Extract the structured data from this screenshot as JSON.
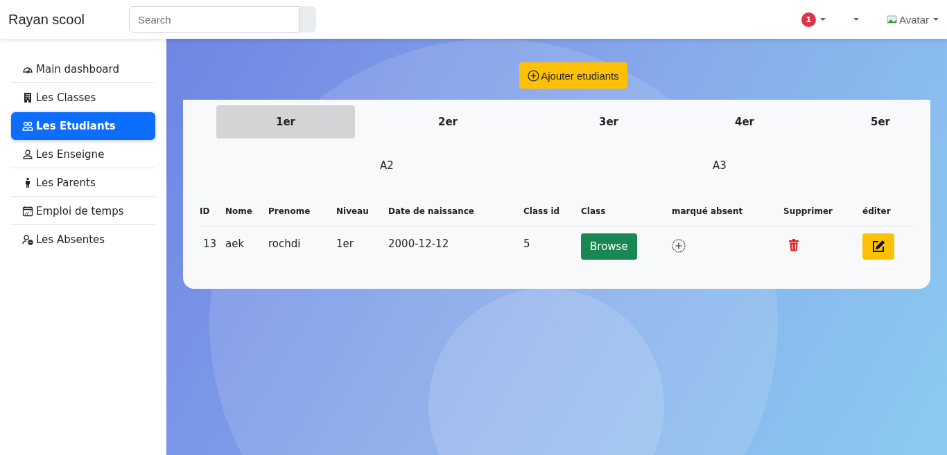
{
  "navbar": {
    "brand": "Rayan scool",
    "search": {
      "placeholder": "Search"
    },
    "notification_count": "1",
    "avatar_alt": "Avatar"
  },
  "sidebar": {
    "items": [
      {
        "label": "Main dashboard",
        "selected": false
      },
      {
        "label": "Les Classes",
        "selected": false
      },
      {
        "label": "Les Etudiants",
        "selected": true
      },
      {
        "label": "Les Enseigne",
        "selected": false
      },
      {
        "label": "Les Parents",
        "selected": false
      },
      {
        "label": "Emploi de temps",
        "selected": false
      },
      {
        "label": "Les Absentes",
        "selected": false
      }
    ]
  },
  "add_button": "Ajouter etudiants",
  "level_tabs": [
    {
      "label": "1er",
      "selected": true
    },
    {
      "label": "2er",
      "selected": false
    },
    {
      "label": "3er",
      "selected": false
    },
    {
      "label": "4er",
      "selected": false
    },
    {
      "label": "5er",
      "selected": false
    }
  ],
  "groups": [
    "A2",
    "A3"
  ],
  "table": {
    "columns": [
      "ID",
      "Nome",
      "Prenome",
      "Niveau",
      "Date de naissance",
      "Class id",
      "Class",
      "marqué absent",
      "Supprimer",
      "éditer"
    ],
    "rows": [
      {
        "id": "13",
        "nome": "aek",
        "prenome": "rochdi",
        "niveau": "1er",
        "date": "2000-12-12",
        "class_id": "5",
        "class_button": "Browse"
      }
    ]
  }
}
